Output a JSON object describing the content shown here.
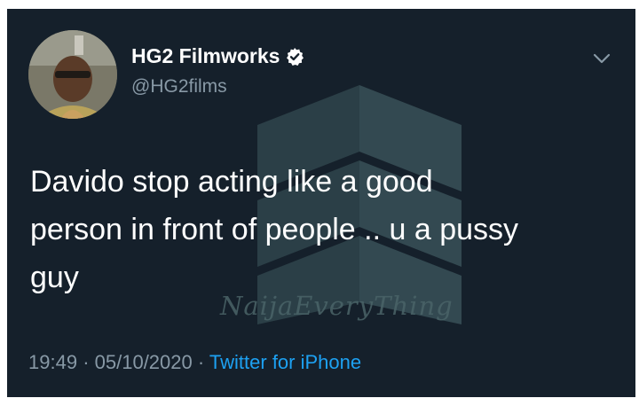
{
  "tweet": {
    "display_name": "HG2 Filmworks",
    "handle": "@HG2films",
    "verified_icon": "verified-badge-icon",
    "text": "Davido stop acting like a good\nperson in front of people .. u a pussy\nguy",
    "time": "19:49",
    "date": "05/10/2020",
    "separator": "·",
    "source": "Twitter for iPhone",
    "menu_icon": "chevron-down-icon"
  },
  "watermark": {
    "text": "NaijaEveryThing",
    "logo_icon": "naijaeverything-logo-icon"
  },
  "colors": {
    "background": "#15202b",
    "text": "#ffffff",
    "muted": "#8899a6",
    "link": "#1da1f2"
  }
}
